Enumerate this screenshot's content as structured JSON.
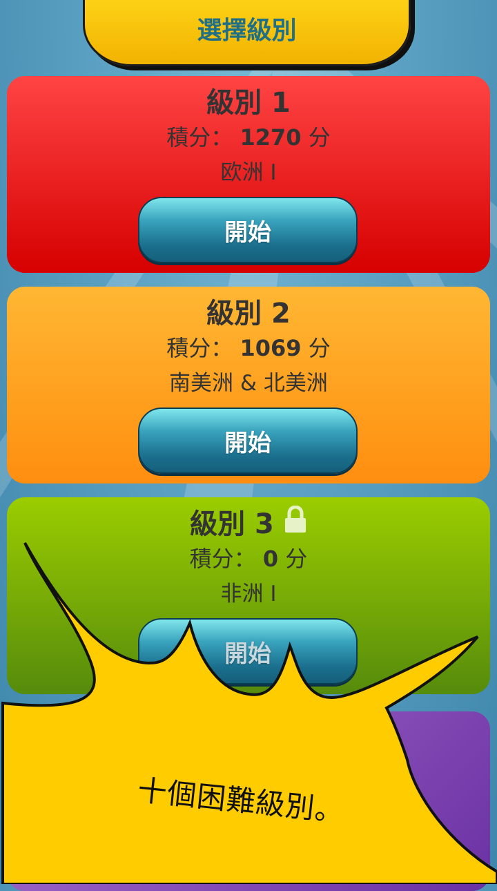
{
  "header": {
    "title": "選擇級別"
  },
  "levels": [
    {
      "title": "級別 1",
      "score_label": "積分：",
      "score_value": "1270",
      "score_unit": "分",
      "region": "欧洲 I",
      "button": "開始"
    },
    {
      "title": "級別 2",
      "score_label": "積分：",
      "score_value": "1069",
      "score_unit": "分",
      "region": "南美洲 & 北美洲",
      "button": "開始"
    },
    {
      "title": "級別 3",
      "score_label": "積分：",
      "score_value": "0",
      "score_unit": "分",
      "region": "非洲 I",
      "button": "開始"
    }
  ],
  "tooltip": {
    "text": "十個困難級別。"
  },
  "colors": {
    "level1": "#e61f1f",
    "level2": "#ffa31f",
    "level3": "#80b300",
    "level4": "#8a4dbd",
    "button": "#2a8aa6",
    "burst": "#ffcc00"
  }
}
